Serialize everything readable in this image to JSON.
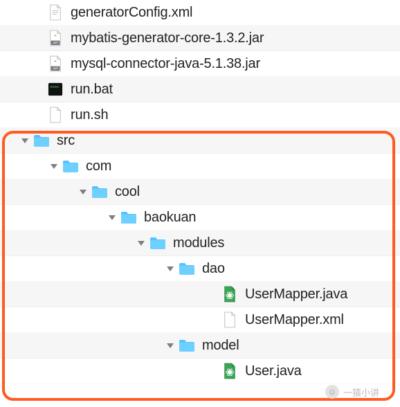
{
  "watermark": "一猿小讲",
  "tree": [
    {
      "depth": 0,
      "arrow": "none",
      "icon": "file-xml",
      "label": "generatorConfig.xml",
      "alt": false
    },
    {
      "depth": 0,
      "arrow": "none",
      "icon": "file-jar",
      "label": "mybatis-generator-core-1.3.2.jar",
      "alt": true
    },
    {
      "depth": 0,
      "arrow": "none",
      "icon": "file-jar",
      "label": "mysql-connector-java-5.1.38.jar",
      "alt": false
    },
    {
      "depth": 0,
      "arrow": "none",
      "icon": "file-bat",
      "label": "run.bat",
      "alt": true
    },
    {
      "depth": 0,
      "arrow": "none",
      "icon": "file",
      "label": "run.sh",
      "alt": false
    },
    {
      "depth": 0,
      "arrow": "down",
      "icon": "folder",
      "label": "src",
      "alt": true
    },
    {
      "depth": 1,
      "arrow": "down",
      "icon": "folder",
      "label": "com",
      "alt": false
    },
    {
      "depth": 2,
      "arrow": "down",
      "icon": "folder",
      "label": "cool",
      "alt": true
    },
    {
      "depth": 3,
      "arrow": "down",
      "icon": "folder",
      "label": "baokuan",
      "alt": false
    },
    {
      "depth": 4,
      "arrow": "down",
      "icon": "folder",
      "label": "modules",
      "alt": true
    },
    {
      "depth": 5,
      "arrow": "down",
      "icon": "folder",
      "label": "dao",
      "alt": false
    },
    {
      "depth": 6,
      "arrow": "none",
      "icon": "file-java",
      "label": "UserMapper.java",
      "alt": true
    },
    {
      "depth": 6,
      "arrow": "none",
      "icon": "file-xml2",
      "label": "UserMapper.xml",
      "alt": false
    },
    {
      "depth": 5,
      "arrow": "down",
      "icon": "folder",
      "label": "model",
      "alt": true
    },
    {
      "depth": 6,
      "arrow": "none",
      "icon": "file-java",
      "label": "User.java",
      "alt": false
    }
  ]
}
